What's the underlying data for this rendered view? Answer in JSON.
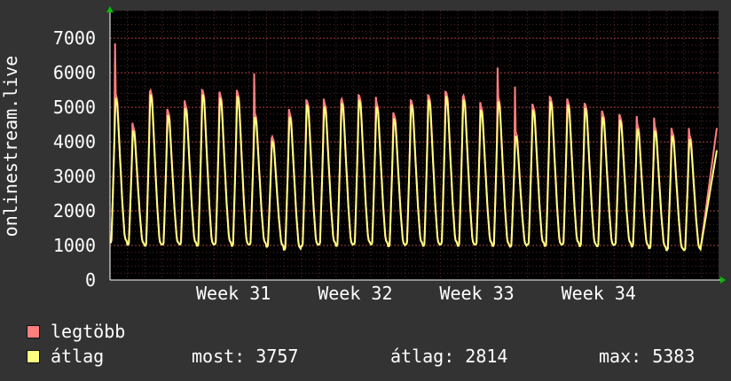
{
  "chart_data": {
    "type": "line",
    "ylabel": "onlinestream.live",
    "y_ticks": [
      "0",
      "1000",
      "2000",
      "3000",
      "4000",
      "5000",
      "6000",
      "7000"
    ],
    "ylim": [
      0,
      7800
    ],
    "x_ticks": [
      "Week 31",
      "Week 32",
      "Week 33",
      "Week 34"
    ],
    "x_start": "Week 30 (late)",
    "days": 35,
    "grid": true,
    "background": "#000000",
    "series": [
      {
        "name": "legtöbb",
        "color": "#ff7f7f",
        "daily_peaks": [
          6850,
          4550,
          5450,
          4950,
          5200,
          5500,
          5450,
          5500,
          5980,
          4100,
          4950,
          5200,
          5250,
          5200,
          5350,
          5300,
          4850,
          5200,
          5350,
          5450,
          5300,
          5150,
          6150,
          5600,
          5100,
          5300,
          5250,
          5100,
          4900,
          4800,
          4750,
          4700,
          4400,
          4400
        ]
      },
      {
        "name": "átlag",
        "color": "#ffff7f",
        "daily_peaks": [
          5300,
          4350,
          5400,
          4800,
          5000,
          5400,
          5300,
          5350,
          4750,
          4050,
          4750,
          5100,
          5050,
          5150,
          5250,
          5050,
          4700,
          5100,
          5250,
          5350,
          5250,
          4950,
          5200,
          4200,
          4950,
          5200,
          5100,
          5000,
          4750,
          4650,
          4400,
          4350,
          4200,
          4100
        ],
        "daily_troughs": [
          1000,
          950,
          900,
          950,
          950,
          900,
          950,
          900,
          950,
          900,
          800,
          900,
          950,
          900,
          950,
          950,
          900,
          950,
          900,
          950,
          900,
          950,
          900,
          900,
          950,
          900,
          950,
          900,
          900,
          950,
          900,
          850,
          800,
          800
        ],
        "last_value": 3757
      }
    ]
  },
  "legend": {
    "max_label": "legtöbb",
    "avg_label": "átlag",
    "max_color": "#ff7f7f",
    "avg_color": "#ffff7f"
  },
  "stats": {
    "current": "most: 3757",
    "average": "átlag: 2814",
    "maximum": "max: 5383"
  }
}
